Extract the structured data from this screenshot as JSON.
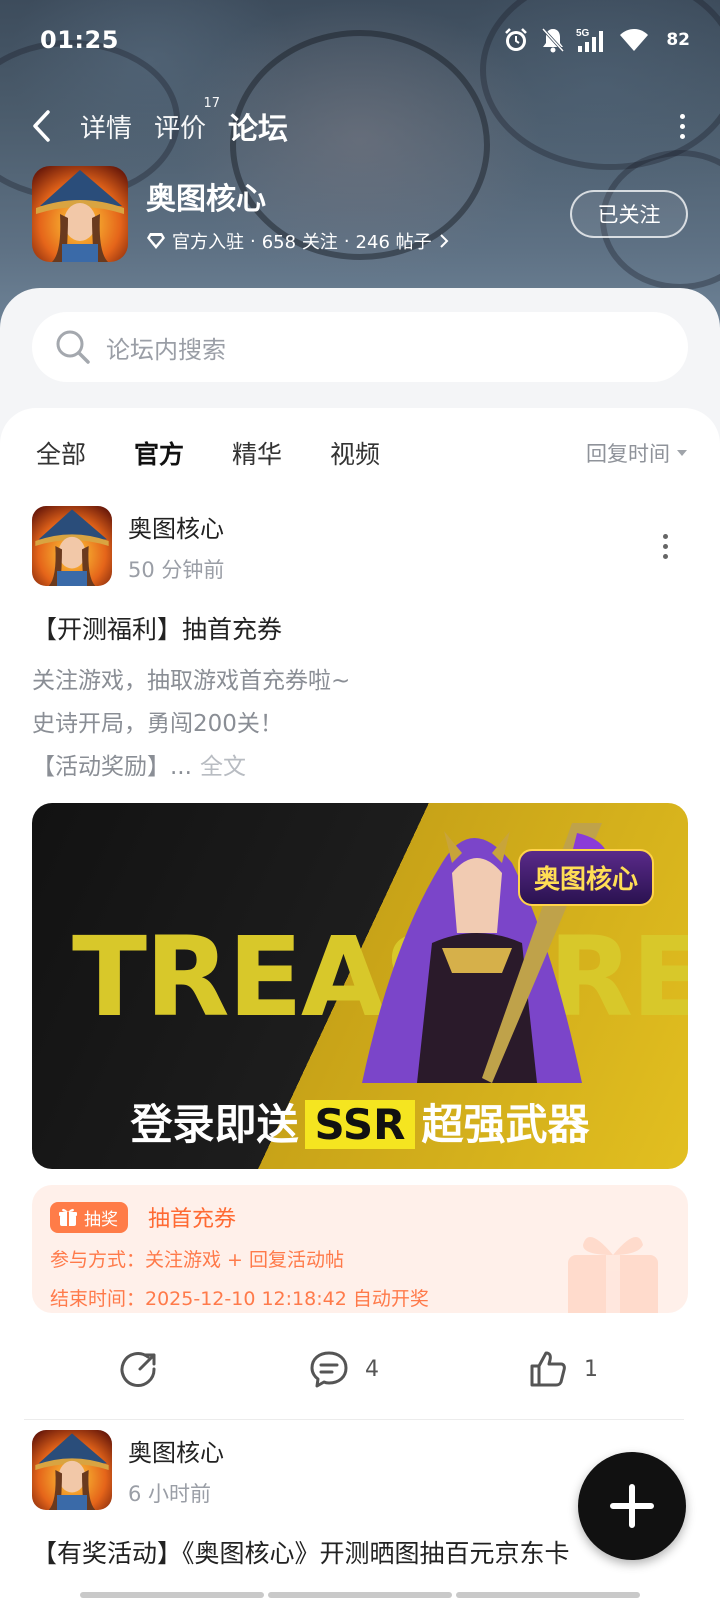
{
  "status_bar": {
    "time": "01:25",
    "network": "5G",
    "battery": "82"
  },
  "nav": {
    "tabs": [
      {
        "label": "详情"
      },
      {
        "label": "评价",
        "badge": "17"
      },
      {
        "label": "论坛"
      }
    ],
    "active_tab": "论坛"
  },
  "app": {
    "name": "奥图核心",
    "verified": "官方入驻",
    "followers": "658 关注",
    "posts": "246 帖子",
    "sep": "·",
    "follow_button": "已关注"
  },
  "search": {
    "placeholder": "论坛内搜索"
  },
  "filters": {
    "items": [
      "全部",
      "官方",
      "精华",
      "视频"
    ],
    "active": "官方",
    "sort": "回复时间"
  },
  "posts": [
    {
      "author": "奥图核心",
      "time": "50 分钟前",
      "title": "【开测福利】抽首充券",
      "body_lines": [
        "关注游戏，抽取游戏首充券啦~",
        "史诗开局，勇闯200关！",
        "【活动奖励】..."
      ],
      "more_link": "全文",
      "banner": {
        "big_text": "TREASURE",
        "brand": "奥图核心",
        "caption_pre": "登录即送",
        "caption_ssr": "SSR",
        "caption_post": "超强武器"
      },
      "lottery": {
        "tag": "抽奖",
        "title": "抽首充券",
        "method": "参与方式：关注游戏 + 回复活动帖",
        "end_time": "结束时间：2025-12-10 12:18:42 自动开奖"
      },
      "comments": "4",
      "likes": "1"
    },
    {
      "author": "奥图核心",
      "time": "6 小时前",
      "title": "【有奖活动】《奥图核心》开测晒图抽百元京东卡"
    }
  ]
}
